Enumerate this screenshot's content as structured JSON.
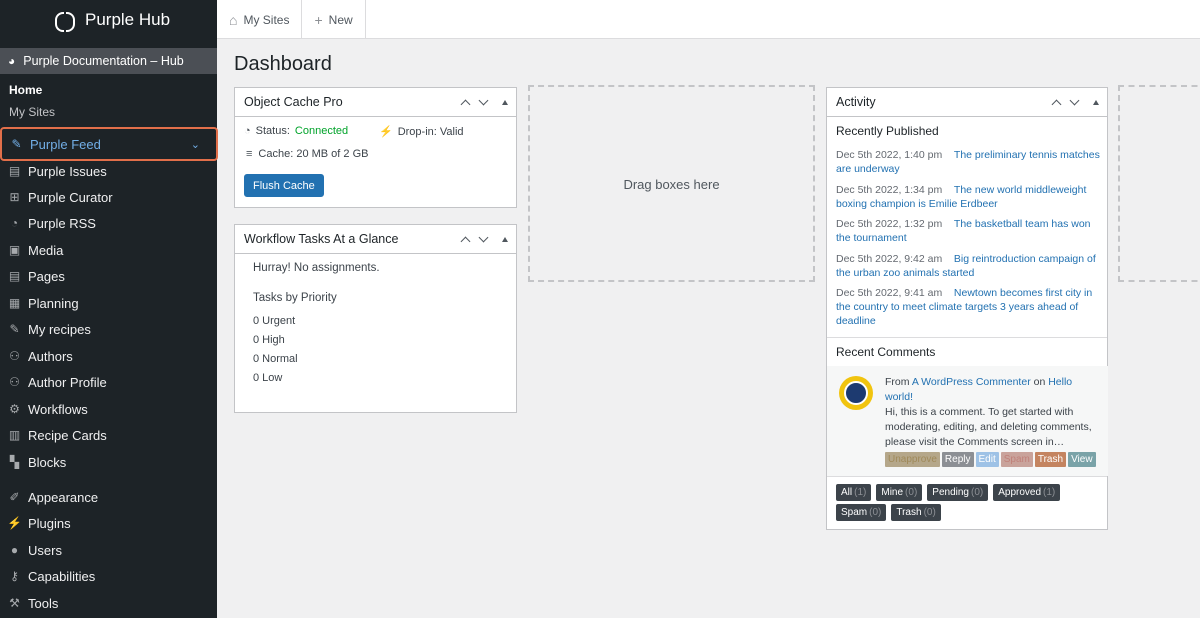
{
  "brand": {
    "title": "Purple Hub"
  },
  "sidebar": {
    "site_row": "Purple Documentation – Hub",
    "sub_items": [
      "Home",
      "My Sites"
    ],
    "feed_label": "Purple Feed",
    "items": [
      {
        "label": "Purple Issues",
        "icon": "pages-icon"
      },
      {
        "label": "Purple Curator",
        "icon": "grid-icon"
      },
      {
        "label": "Purple RSS",
        "icon": "rss-icon"
      },
      {
        "label": "Media",
        "icon": "media-icon"
      },
      {
        "label": "Pages",
        "icon": "pages-icon"
      },
      {
        "label": "Planning",
        "icon": "calendar-icon"
      },
      {
        "label": "My recipes",
        "icon": "pin-icon"
      },
      {
        "label": "Authors",
        "icon": "groups-icon"
      },
      {
        "label": "Author Profile",
        "icon": "groups-icon"
      },
      {
        "label": "Workflows",
        "icon": "gear-icon"
      },
      {
        "label": "Recipe Cards",
        "icon": "book-icon"
      },
      {
        "label": "Blocks",
        "icon": "blocks-icon"
      },
      {
        "label": "Appearance",
        "icon": "brush-icon"
      },
      {
        "label": "Plugins",
        "icon": "plugin-icon"
      },
      {
        "label": "Users",
        "icon": "user-icon"
      },
      {
        "label": "Capabilities",
        "icon": "key-icon"
      },
      {
        "label": "Tools",
        "icon": "wrench-icon"
      }
    ]
  },
  "topbar": {
    "my_sites": "My Sites",
    "new": "New"
  },
  "page": {
    "title": "Dashboard"
  },
  "object_cache": {
    "title": "Object Cache Pro",
    "status_label": "Status:",
    "status_value": "Connected",
    "dropin": "Drop-in: Valid",
    "cache": "Cache: 20 MB of 2 GB",
    "flush_button": "Flush Cache",
    "status_color": "#00a32a"
  },
  "workflow": {
    "title": "Workflow Tasks At a Glance",
    "no_assign": "Hurray! No assignments.",
    "priority_heading": "Tasks by Priority",
    "priorities": [
      "0 Urgent",
      "0 High",
      "0 Normal",
      "0 Low"
    ]
  },
  "dropzone": {
    "label": "Drag boxes here"
  },
  "activity": {
    "title": "Activity",
    "recent_published": "Recently Published",
    "published": [
      {
        "date": "Dec 5th 2022, 1:40 pm",
        "title": "The preliminary tennis matches are underway"
      },
      {
        "date": "Dec 5th 2022, 1:34 pm",
        "title": "The new world middleweight boxing champion is Emilie Erdbeer"
      },
      {
        "date": "Dec 5th 2022, 1:32 pm",
        "title": "The basketball team has won the tournament"
      },
      {
        "date": "Dec 5th 2022, 9:42 am",
        "title": "Big reintroduction campaign of the urban zoo animals started"
      },
      {
        "date": "Dec 5th 2022, 9:41 am",
        "title": "Newtown becomes first city in the country to meet climate targets 3 years ahead of deadline"
      }
    ],
    "recent_comments": "Recent Comments",
    "comment": {
      "from": "From",
      "author": "A WordPress Commenter",
      "on": "on",
      "post": "Hello world!",
      "text": "Hi, this is a comment. To get started with moderating, editing, and deleting comments, please visit the Comments screen in…",
      "actions": [
        {
          "label": "Unapprove",
          "color": "#b5a78a"
        },
        {
          "label": "Reply",
          "color": "#8c8f94"
        },
        {
          "label": "Edit",
          "color": "#9ec2e6"
        },
        {
          "label": "Spam",
          "color": "#c9a39b"
        },
        {
          "label": "Trash",
          "color": "#c48460"
        },
        {
          "label": "View",
          "color": "#7aa3a8"
        }
      ]
    },
    "filters": [
      {
        "label": "All",
        "count": "(1)"
      },
      {
        "label": "Mine",
        "count": "(0)"
      },
      {
        "label": "Pending",
        "count": "(0)"
      },
      {
        "label": "Approved",
        "count": "(1)"
      },
      {
        "label": "Spam",
        "count": "(0)"
      },
      {
        "label": "Trash",
        "count": "(0)"
      }
    ]
  }
}
